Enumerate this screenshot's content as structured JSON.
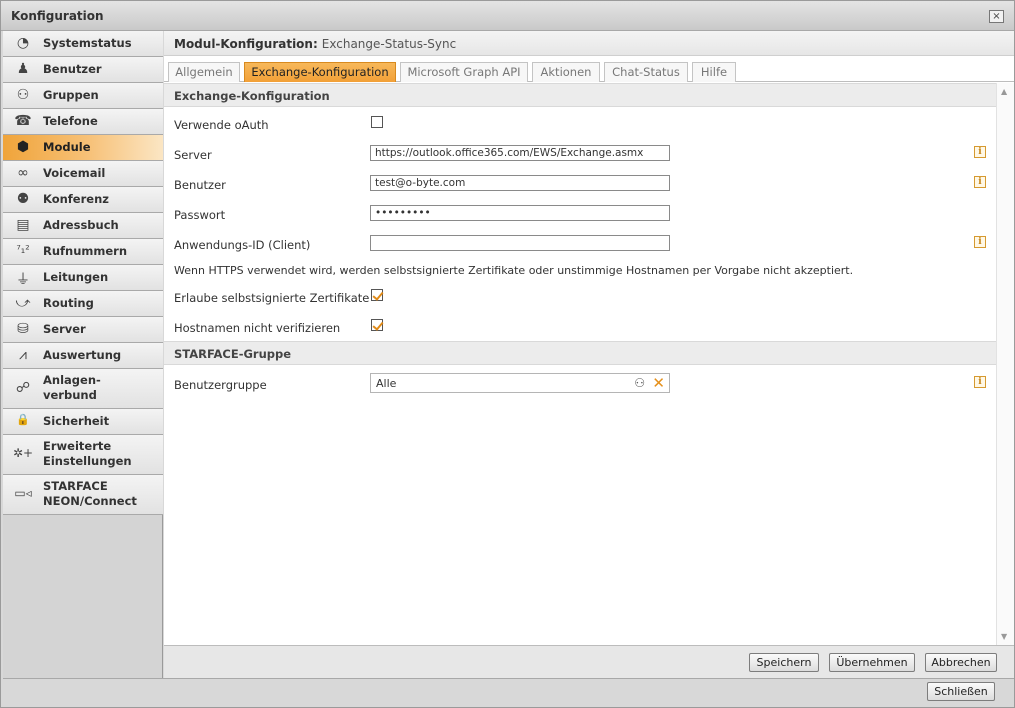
{
  "window": {
    "title": "Konfiguration",
    "close_glyph": "×"
  },
  "sidebar": {
    "items": [
      {
        "label": "Systemstatus",
        "icon": "clock-icon",
        "glyph": "◔"
      },
      {
        "label": "Benutzer",
        "icon": "user-icon",
        "glyph": "♟"
      },
      {
        "label": "Gruppen",
        "icon": "group-icon",
        "glyph": "⚇"
      },
      {
        "label": "Telefone",
        "icon": "phone-icon",
        "glyph": "☎"
      },
      {
        "label": "Module",
        "icon": "cube-icon",
        "glyph": "⬢"
      },
      {
        "label": "Voicemail",
        "icon": "voicemail-icon",
        "glyph": "∞"
      },
      {
        "label": "Konferenz",
        "icon": "conference-icon",
        "glyph": "⚉"
      },
      {
        "label": "Adressbuch",
        "icon": "addressbook-icon",
        "glyph": "▤"
      },
      {
        "label": "Rufnummern",
        "icon": "numbers-icon",
        "glyph": "⁷₁²"
      },
      {
        "label": "Leitungen",
        "icon": "lines-icon",
        "glyph": "⏚"
      },
      {
        "label": "Routing",
        "icon": "routing-icon",
        "glyph": "⤻"
      },
      {
        "label": "Server",
        "icon": "server-icon",
        "glyph": "⛁"
      },
      {
        "label": "Auswertung",
        "icon": "chart-icon",
        "glyph": "⩘"
      },
      {
        "label": "Anlagen-\nverbund",
        "icon": "network-icon",
        "glyph": "☍"
      },
      {
        "label": "Sicherheit",
        "icon": "lock-icon",
        "glyph": "🔒"
      },
      {
        "label": "Erweiterte\nEinstellungen",
        "icon": "settings-plus-icon",
        "glyph": "✲+"
      },
      {
        "label": "STARFACE\nNEON/Connect",
        "icon": "video-icon",
        "glyph": "▭◃"
      }
    ],
    "active": "Module"
  },
  "header": {
    "title": "Modul-Konfiguration:",
    "module": "Exchange-Status-Sync"
  },
  "tabs": [
    "Allgemein",
    "Exchange-Konfiguration",
    "Microsoft Graph API",
    "Aktionen",
    "Chat-Status",
    "Hilfe"
  ],
  "active_tab": "Exchange-Konfiguration",
  "exchange": {
    "section_title": "Exchange-Konfiguration",
    "oauth_label": "Verwende oAuth",
    "oauth_checked": false,
    "server_label": "Server",
    "server_value": "https://outlook.office365.com/EWS/Exchange.asmx",
    "user_label": "Benutzer",
    "user_value": "test@o-byte.com",
    "password_label": "Passwort",
    "password_value": "•••••••••",
    "appid_label": "Anwendungs-ID (Client)",
    "appid_value": "",
    "https_note": "Wenn HTTPS verwendet wird, werden selbstsignierte Zertifikate oder unstimmige Hostnamen per Vorgabe nicht akzeptiert.",
    "selfsigned_label": "Erlaube selbstsignierte Zertifikate",
    "selfsigned_checked": true,
    "hostname_label": "Hostnamen nicht verifizieren",
    "hostname_checked": true,
    "info_glyph": "i"
  },
  "group": {
    "section_title": "STARFACE-Gruppe",
    "usergroup_label": "Benutzergruppe",
    "usergroup_value": "Alle",
    "clear_glyph": "✕",
    "group_glyph": "⚇"
  },
  "footer": {
    "save": "Speichern",
    "apply": "Übernehmen",
    "cancel": "Abbrechen"
  },
  "bottom": {
    "close": "Schließen"
  },
  "colors": {
    "accent": "#f2a037",
    "info": "#d69a30"
  }
}
